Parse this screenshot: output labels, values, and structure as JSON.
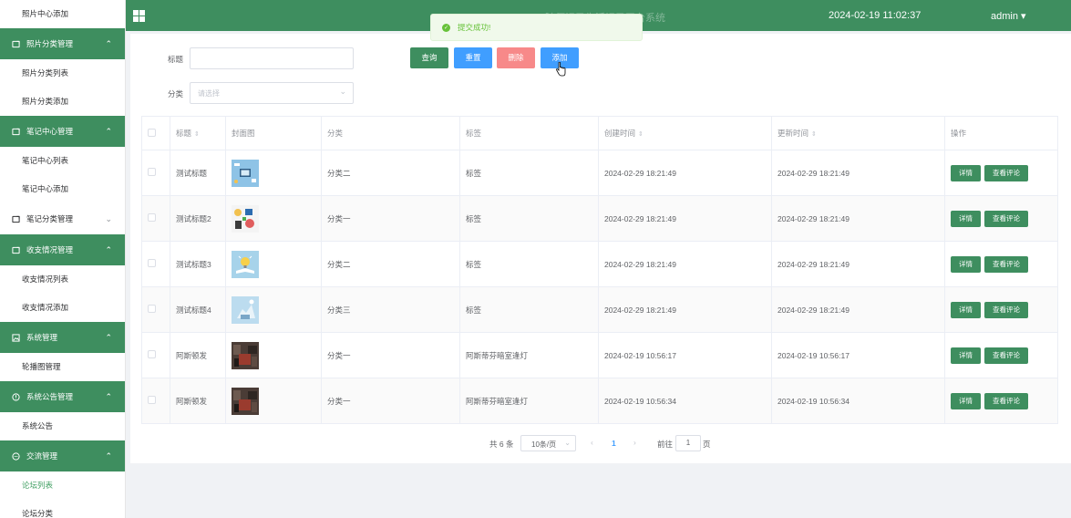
{
  "sidebar": {
    "items": [
      {
        "type": "sub",
        "label": "照片中心添加"
      },
      {
        "type": "group",
        "label": "照片分类管理",
        "icon": "folder-icon",
        "expanded": true
      },
      {
        "type": "sub",
        "label": "照片分类列表"
      },
      {
        "type": "sub",
        "label": "照片分类添加"
      },
      {
        "type": "group",
        "label": "笔记中心管理",
        "icon": "folder-icon",
        "expanded": true
      },
      {
        "type": "sub",
        "label": "笔记中心列表"
      },
      {
        "type": "sub",
        "label": "笔记中心添加"
      },
      {
        "type": "group",
        "label": "笔记分类管理",
        "icon": "folder-icon",
        "expanded": false
      },
      {
        "type": "group",
        "label": "收支情况管理",
        "icon": "folder-icon",
        "expanded": true
      },
      {
        "type": "sub",
        "label": "收支情况列表"
      },
      {
        "type": "sub",
        "label": "收支情况添加"
      },
      {
        "type": "group",
        "label": "系统管理",
        "icon": "image-icon",
        "expanded": true
      },
      {
        "type": "sub",
        "label": "轮播图管理"
      },
      {
        "type": "group",
        "label": "系统公告管理",
        "icon": "info-icon",
        "expanded": true
      },
      {
        "type": "sub",
        "label": "系统公告"
      },
      {
        "type": "group",
        "label": "交流管理",
        "icon": "chat-icon",
        "expanded": true
      },
      {
        "type": "sub",
        "label": "论坛列表",
        "active": true
      },
      {
        "type": "sub",
        "label": "论坛分类"
      }
    ]
  },
  "header": {
    "title": "随便记录生活记录平台系统",
    "datetime": "2024-02-19 11:02:37",
    "user": "admin"
  },
  "toast": {
    "message": "提交成功!"
  },
  "search": {
    "title_label": "标题",
    "title_value": "",
    "category_label": "分类",
    "category_placeholder": "请选择"
  },
  "buttons": {
    "query": "查询",
    "reset": "重置",
    "delete": "删除",
    "add": "添加"
  },
  "table": {
    "headers": [
      "标题",
      "封面图",
      "分类",
      "标签",
      "创建时间",
      "更新时间",
      "操作"
    ],
    "rows": [
      {
        "title": "测试标题",
        "category": "分类二",
        "tag": "标签",
        "created": "2024-02-29 18:21:49",
        "updated": "2024-02-29 18:21:49",
        "thumb": "blue-desk"
      },
      {
        "title": "测试标题2",
        "category": "分类一",
        "tag": "标签",
        "created": "2024-02-29 18:21:49",
        "updated": "2024-02-29 18:21:49",
        "thumb": "colorful-items"
      },
      {
        "title": "测试标题3",
        "category": "分类二",
        "tag": "标签",
        "created": "2024-02-29 18:21:49",
        "updated": "2024-02-29 18:21:49",
        "thumb": "bulb-book"
      },
      {
        "title": "测试标题4",
        "category": "分类三",
        "tag": "标签",
        "created": "2024-02-29 18:21:49",
        "updated": "2024-02-29 18:21:49",
        "thumb": "sky-blue"
      },
      {
        "title": "阿斯顿发",
        "category": "分类一",
        "tag": "阿斯蒂芬暗室逢灯",
        "created": "2024-02-19 10:56:17",
        "updated": "2024-02-19 10:56:17",
        "thumb": "dark-room"
      },
      {
        "title": "阿斯顿发",
        "category": "分类一",
        "tag": "阿斯蒂芬暗室逢灯",
        "created": "2024-02-19 10:56:34",
        "updated": "2024-02-19 10:56:34",
        "thumb": "dark-room"
      }
    ],
    "op_detail": "详情",
    "op_comment": "查看评论"
  },
  "pagination": {
    "total": "共 6 条",
    "page_size": "10条/页",
    "current_page": "1",
    "goto_label": "前往",
    "goto_value": "1",
    "page_suffix": "页"
  },
  "colors": {
    "primary": "#3e8e5f",
    "blue": "#409eff",
    "danger": "#f78989",
    "success_toast": "#f0f9eb"
  }
}
